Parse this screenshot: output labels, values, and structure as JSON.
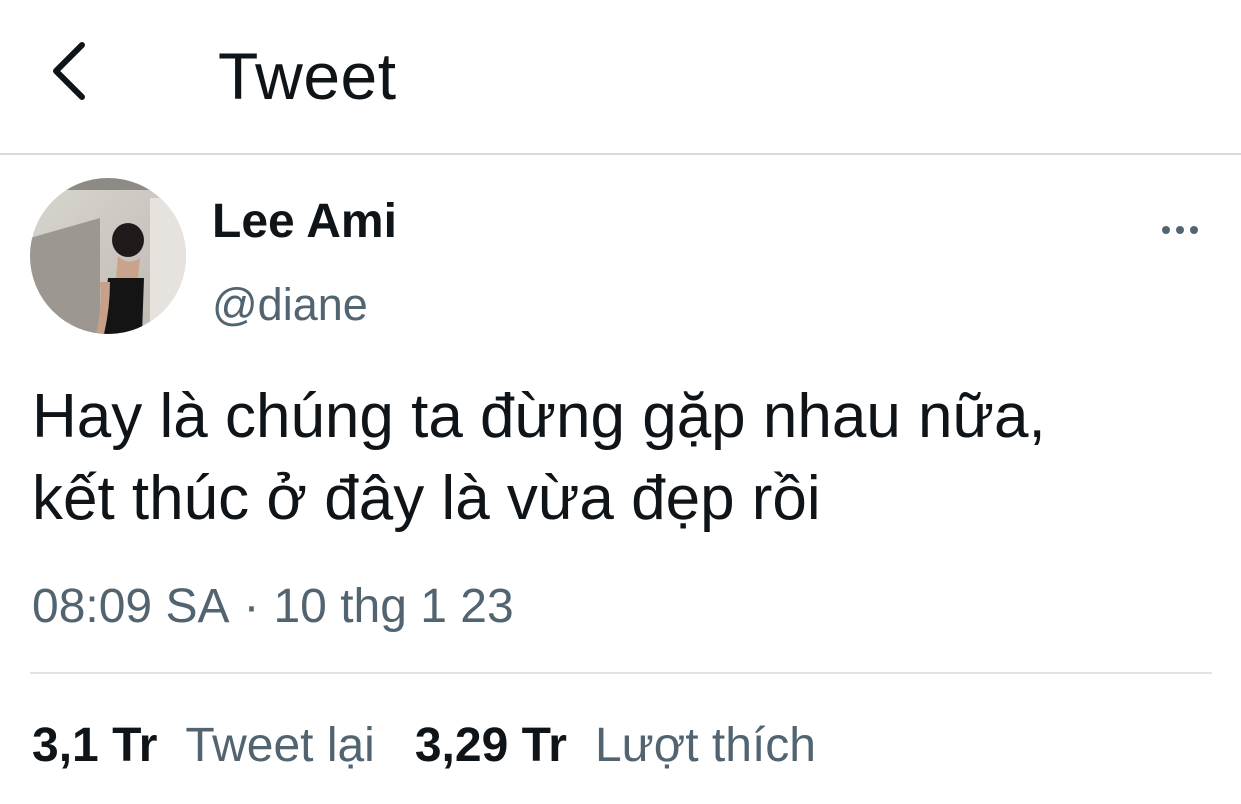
{
  "header": {
    "title": "Tweet",
    "back_icon": "chevron-left-icon"
  },
  "author": {
    "display_name": "Lee Ami",
    "handle": "@diane",
    "avatar": "avatar-photo"
  },
  "more_icon": "more-horizontal-icon",
  "tweet": {
    "lines": [
      "Hay là chúng ta đừng gặp nhau nữa,",
      "kết thúc ở đây là vừa đẹp rồi"
    ]
  },
  "meta": {
    "time": "08:09 SA",
    "separator": "·",
    "date": "10 thg 1 23"
  },
  "stats": {
    "retweets": {
      "count": "3,1 Tr",
      "label": "Tweet lại"
    },
    "likes": {
      "count": "3,29 Tr",
      "label": "Lượt thích"
    }
  },
  "colors": {
    "text_primary": "#0f1419",
    "text_secondary": "#536471",
    "divider": "#d9d9d9"
  }
}
